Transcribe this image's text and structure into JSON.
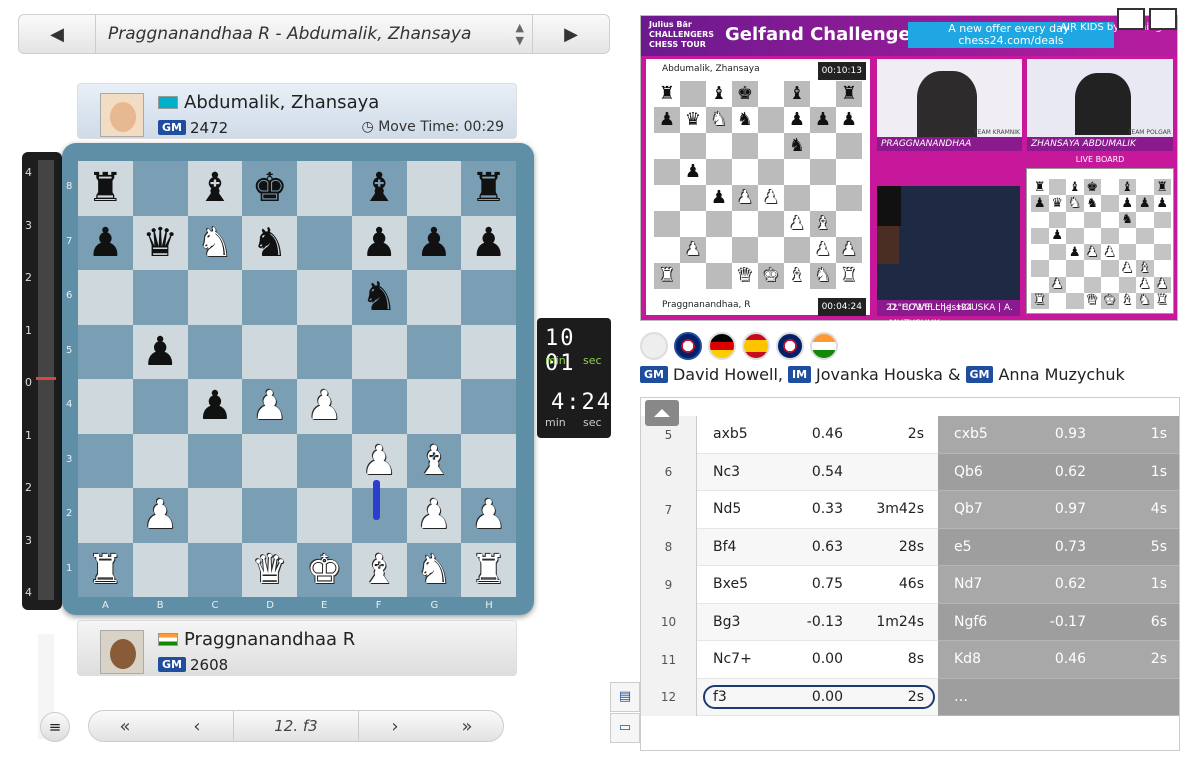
{
  "nav": {
    "prev": "◀",
    "next": "▶",
    "title": "Praggnanandhaa R - Abdumalik, Zhansaya"
  },
  "top_player": {
    "name": "Abdumalik, Zhansaya",
    "title": "GM",
    "rating": "2472",
    "move_time": "Move Time: 00:29"
  },
  "bottom_player": {
    "name": "Praggnanandhaa R",
    "title": "GM",
    "rating": "2608"
  },
  "eval_ticks": [
    "4",
    "3",
    "2",
    "1",
    "0",
    "1",
    "2",
    "3",
    "4"
  ],
  "board": {
    "files": [
      "A",
      "B",
      "C",
      "D",
      "E",
      "F",
      "G",
      "H"
    ],
    "ranks": [
      "8",
      "7",
      "6",
      "5",
      "4",
      "3",
      "2",
      "1"
    ],
    "rows": [
      [
        "b:♜",
        "",
        "b:♝",
        "b:♚",
        "",
        "b:♝",
        "",
        "b:♜"
      ],
      [
        "b:♟",
        "b:♛",
        "w:♞",
        "b:♞",
        "",
        "b:♟",
        "b:♟",
        "b:♟"
      ],
      [
        "",
        "",
        "",
        "",
        "",
        "b:♞",
        "",
        ""
      ],
      [
        "",
        "b:♟",
        "",
        "",
        "",
        "",
        "",
        ""
      ],
      [
        "",
        "",
        "b:♟",
        "w:♟",
        "w:♟",
        "",
        "",
        ""
      ],
      [
        "",
        "",
        "",
        "",
        "",
        "w:♟",
        "w:♝",
        ""
      ],
      [
        "",
        "w:♟",
        "",
        "",
        "",
        "",
        "w:♟",
        "w:♟"
      ],
      [
        "w:♜",
        "",
        "",
        "w:♛",
        "w:♚",
        "w:♝",
        "w:♞",
        "w:♜"
      ]
    ]
  },
  "clock": {
    "top": "10 01",
    "top_min": "min",
    "top_sec": "sec",
    "bottom": "4:24",
    "bot_min": "min",
    "bot_sec": "sec"
  },
  "bottom_nav": {
    "first": "«",
    "prev": "‹",
    "move": "12. f3",
    "next": "›",
    "last": "»",
    "menu": "≡"
  },
  "video": {
    "logo": "Julius Bär CHALLENGERS CHESS TOUR",
    "title": "Gelfand Challenge",
    "offer": "A new offer every day! chess24.com/deals",
    "air": "AIR KIDS by Airthings",
    "mini_top": "Abdumalik, Zhansaya",
    "mini_top_time": "00:10:13",
    "mini_bot": "Praggnanandhaa, R",
    "mini_bot_time": "00:04:24",
    "cam1": "PRAGGNANANDHAA",
    "cam1_team": "TEAM KRAMNIK",
    "cam2": "ZHANSAYA ABDUMALIK",
    "cam2_team": "TEAM POLGAR",
    "live": "LIVE BOARD",
    "studio": "D. HOWELL | J. HOUSKA | A. MUZYCHUK",
    "footer": "22°C/71°F  chess24"
  },
  "commentary": {
    "p1_title": "GM",
    "p1": "David Howell,",
    "p2_title": "IM",
    "p2": "Jovanka Houska &",
    "p3_title": "GM",
    "p3": "Anna Muzychuk"
  },
  "moves": [
    {
      "n": "5",
      "w": "axb5",
      "we": "0.46",
      "wt": "2s",
      "b": "cxb5",
      "be": "0.93",
      "bt": "1s"
    },
    {
      "n": "6",
      "w": "Nc3",
      "we": "0.54",
      "wt": "",
      "b": "Qb6",
      "be": "0.62",
      "bt": "1s"
    },
    {
      "n": "7",
      "w": "Nd5",
      "we": "0.33",
      "wt": "3m42s",
      "b": "Qb7",
      "be": "0.97",
      "bt": "4s"
    },
    {
      "n": "8",
      "w": "Bf4",
      "we": "0.63",
      "wt": "28s",
      "b": "e5",
      "be": "0.73",
      "bt": "5s"
    },
    {
      "n": "9",
      "w": "Bxe5",
      "we": "0.75",
      "wt": "46s",
      "b": "Nd7",
      "be": "0.62",
      "bt": "1s"
    },
    {
      "n": "10",
      "w": "Bg3",
      "we": "-0.13",
      "wt": "1m24s",
      "b": "Ngf6",
      "be": "-0.17",
      "bt": "6s"
    },
    {
      "n": "11",
      "w": "Nc7+",
      "we": "0.00",
      "wt": "8s",
      "b": "Kd8",
      "be": "0.46",
      "bt": "2s"
    },
    {
      "n": "12",
      "w": "f3",
      "we": "0.00",
      "wt": "2s",
      "b": "…",
      "be": "",
      "bt": ""
    }
  ]
}
